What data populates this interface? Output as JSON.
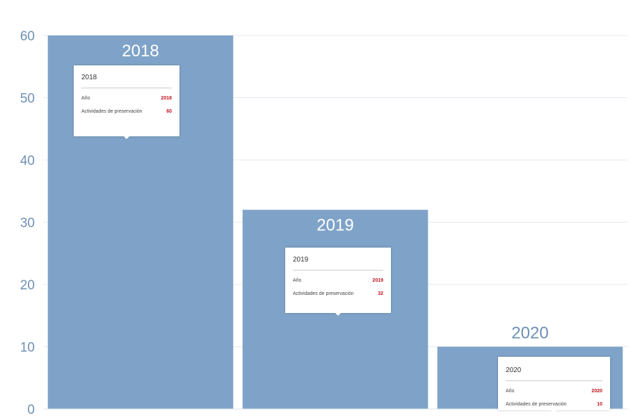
{
  "chart_data": {
    "type": "bar",
    "categories": [
      "2018",
      "2019",
      "2020"
    ],
    "values": [
      60,
      32,
      10
    ],
    "ylim": [
      0,
      60
    ],
    "yticks": [
      0,
      10,
      20,
      30,
      40,
      50,
      60
    ],
    "grid": true,
    "bar_color": "#7fa3c8",
    "grid_color": "#e4eaf0",
    "tick_color": "#6e90b4",
    "label_color": "#ffffff",
    "label_color_outside": "#6e90b4",
    "value_color": "#c1121c"
  },
  "tooltips": [
    {
      "title": "2018",
      "rows": [
        {
          "label": "Año",
          "value": "2018"
        },
        {
          "label": "Actividades de preservación",
          "value": "60"
        }
      ]
    },
    {
      "title": "2019",
      "rows": [
        {
          "label": "Año",
          "value": "2019"
        },
        {
          "label": "Actividades de preservación",
          "value": "32"
        }
      ]
    },
    {
      "title": "2020",
      "rows": [
        {
          "label": "Año",
          "value": "2020"
        },
        {
          "label": "Actividades de preservación",
          "value": "10"
        }
      ]
    }
  ]
}
